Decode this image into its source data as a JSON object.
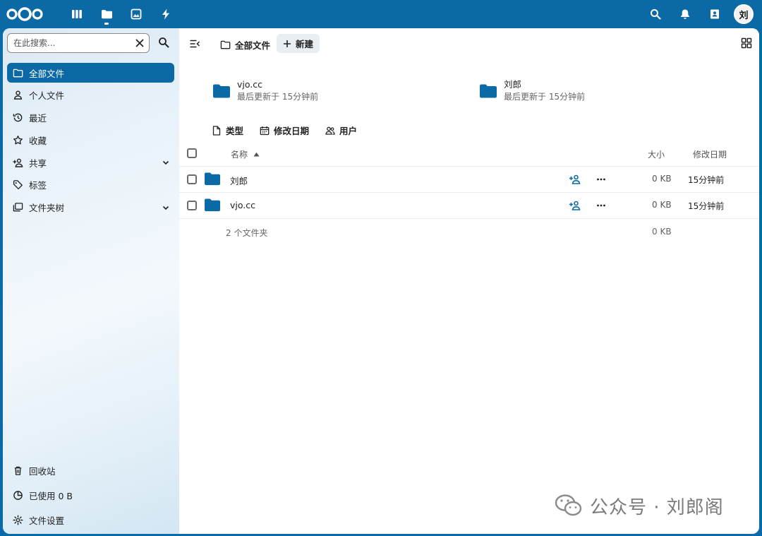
{
  "topbar": {
    "apps": [
      "dashboard-icon",
      "files-icon",
      "photos-icon",
      "activity-icon"
    ],
    "active_app": "files",
    "right": [
      "search-icon",
      "bell-icon",
      "contacts-icon"
    ],
    "avatar_initial": "刘"
  },
  "sidebar": {
    "search_placeholder": "在此搜索...",
    "items": [
      {
        "label": "全部文件",
        "icon": "folder-icon",
        "active": true
      },
      {
        "label": "个人文件",
        "icon": "user-icon"
      },
      {
        "label": "最近",
        "icon": "history-icon"
      },
      {
        "label": "收藏",
        "icon": "star-icon"
      },
      {
        "label": "共享",
        "icon": "share-icon",
        "expandable": true
      },
      {
        "label": "标签",
        "icon": "tag-icon"
      },
      {
        "label": "文件夹树",
        "icon": "folder-tree-icon",
        "expandable": true
      }
    ],
    "bottom": [
      {
        "label": "回收站",
        "icon": "trash-icon"
      },
      {
        "label": "已使用 0 B",
        "icon": "quota-icon"
      },
      {
        "label": "文件设置",
        "icon": "gear-icon"
      }
    ]
  },
  "toolbar": {
    "breadcrumb": "全部文件",
    "new_label": "新建"
  },
  "recent": [
    {
      "name": "vjo.cc",
      "sub": "最后更新于 15分钟前"
    },
    {
      "name": "刘郎",
      "sub": "最后更新于 15分钟前"
    }
  ],
  "filters": {
    "type": "类型",
    "modified": "修改日期",
    "people": "用户"
  },
  "table": {
    "headers": {
      "name": "名称",
      "size": "大小",
      "modified": "修改日期"
    },
    "rows": [
      {
        "name": "刘郎",
        "size": "0 KB",
        "modified": "15分钟前"
      },
      {
        "name": "vjo.cc",
        "size": "0 KB",
        "modified": "15分钟前"
      }
    ],
    "summary": {
      "count": "2 个文件夹",
      "size": "0 KB"
    }
  },
  "watermark": "公众号 · 刘郎阁",
  "colors": {
    "primary": "#0b6aa6",
    "folder": "#0b6aa6"
  }
}
